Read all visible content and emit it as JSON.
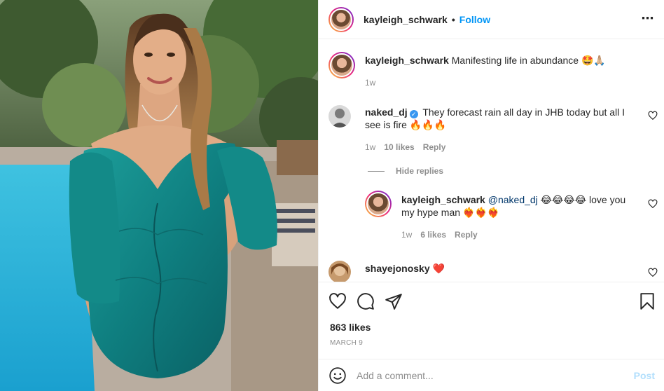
{
  "header": {
    "username": "kayleigh_schwark",
    "separator": "•",
    "follow_label": "Follow",
    "more_label": "⋯"
  },
  "caption": {
    "username": "kayleigh_schwark",
    "text": "Manifesting life in abundance 🤩🙏🏼",
    "time": "1w"
  },
  "comments": [
    {
      "username": "naked_dj",
      "verified": true,
      "text": "They forecast rain all day in JHB today but all I see is fire 🔥🔥🔥",
      "time": "1w",
      "likes": "10 likes",
      "reply_label": "Reply"
    },
    {
      "username": "shayejonosky",
      "text": "❤️"
    }
  ],
  "hide_replies_label": "Hide replies",
  "reply": {
    "username": "kayleigh_schwark",
    "mention": "@naked_dj",
    "text": " 😂😂😂😂 love you my hype man ❤️‍🔥❤️‍🔥❤️‍🔥",
    "time": "1w",
    "likes": "6 likes",
    "reply_label": "Reply"
  },
  "post": {
    "likes": "863 likes",
    "date": "MARCH 9"
  },
  "add_comment": {
    "placeholder": "Add a comment...",
    "post_label": "Post"
  },
  "icons": {
    "like": "heart-icon",
    "comment": "comment-icon",
    "share": "share-icon",
    "save": "bookmark-icon",
    "emoji": "emoji-icon",
    "more": "more-icon"
  },
  "colors": {
    "accent": "#0095f6",
    "post_disabled": "#b2dffc",
    "muted": "#8e8e8e",
    "text": "#262626"
  }
}
